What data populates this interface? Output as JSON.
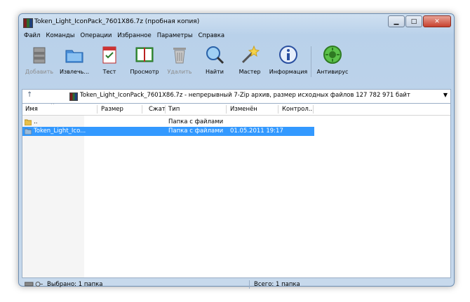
{
  "title": "Token_Light_IconPack_7601X86.7z (пробная копия)",
  "menu": [
    "Файл",
    "Команды",
    "Операции",
    "Избранное",
    "Параметры",
    "Справка"
  ],
  "toolbar": [
    {
      "label": "Добавить",
      "icon": "add-archive-icon",
      "disabled": true
    },
    {
      "label": "Извлечь...",
      "icon": "extract-icon",
      "disabled": false
    },
    {
      "label": "Тест",
      "icon": "test-icon",
      "disabled": false
    },
    {
      "label": "Просмотр",
      "icon": "view-icon",
      "disabled": false
    },
    {
      "label": "Удалить",
      "icon": "delete-icon",
      "disabled": true
    },
    {
      "label": "Найти",
      "icon": "find-icon",
      "disabled": false
    },
    {
      "label": "Мастер",
      "icon": "wizard-icon",
      "disabled": false
    },
    {
      "label": "Информация",
      "icon": "info-icon",
      "disabled": false
    },
    {
      "label": "Антивирус",
      "icon": "antivirus-icon",
      "disabled": false
    }
  ],
  "address": "Token_Light_IconPack_7601X86.7z - непрерывный 7-Zip архив, размер исходных файлов 127 782 971 байт",
  "columns": [
    "Имя",
    "Размер",
    "Сжат",
    "Тип",
    "Изменён",
    "Контрол..."
  ],
  "rows": [
    {
      "name": "..",
      "size": "",
      "packed": "",
      "type": "Папка с файлами",
      "modified": "",
      "crc": ""
    },
    {
      "name": "Token_Light_Ico...",
      "size": "",
      "packed": "",
      "type": "Папка с файлами",
      "modified": "01.05.2011 19:17",
      "crc": ""
    }
  ],
  "status": {
    "selected": "Выбрано: 1 папка",
    "total": "Всего: 1 папка"
  },
  "colors": {
    "selection": "#3399ff",
    "frame": "#b9d1ea"
  }
}
